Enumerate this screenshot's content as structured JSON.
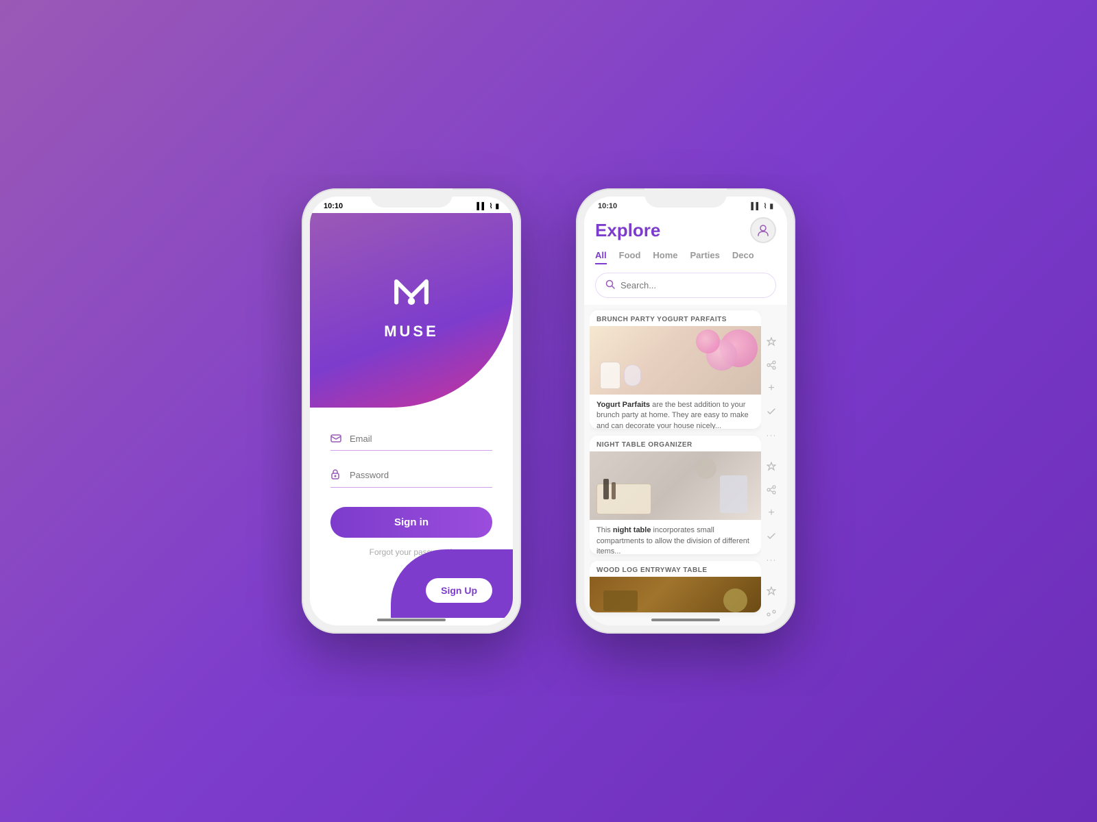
{
  "background": {
    "color_start": "#9b59b6",
    "color_end": "#6c2db8"
  },
  "login_phone": {
    "status_bar": {
      "time": "10:10",
      "icons": "▲ ▌▌ ☁ 🔋"
    },
    "logo_text": "MUSE",
    "email_placeholder": "Email",
    "password_placeholder": "Password",
    "signin_label": "Sign in",
    "forgot_password_label": "Forgot your password?",
    "signup_label": "Sign Up"
  },
  "explore_phone": {
    "status_bar": {
      "time": "10:10",
      "icons": "▲ ▌▌ ☁ 🔋"
    },
    "title": "Explore",
    "categories": [
      {
        "label": "All",
        "active": true
      },
      {
        "label": "Food",
        "active": false
      },
      {
        "label": "Home",
        "active": false
      },
      {
        "label": "Parties",
        "active": false
      },
      {
        "label": "Deco",
        "active": false
      }
    ],
    "search_placeholder": "Search...",
    "cards": [
      {
        "title": "BRUNCH PARTY YOGURT PARFAITS",
        "description_bold": "Yogurt Parfaits",
        "description_rest": " are the best addition to your brunch party at home. They are easy to make and can decorate your house nicely..."
      },
      {
        "title": "NIGHT TABLE ORGANIZER",
        "description_bold": "This night table",
        "description_rest": " incorporates small compartments to allow the division of different items..."
      },
      {
        "title": "WOOD LOG ENTRYWAY TABLE",
        "description_bold": "",
        "description_rest": ""
      }
    ],
    "side_actions": [
      "☆",
      "⑂",
      "+",
      "✓",
      "···"
    ]
  }
}
